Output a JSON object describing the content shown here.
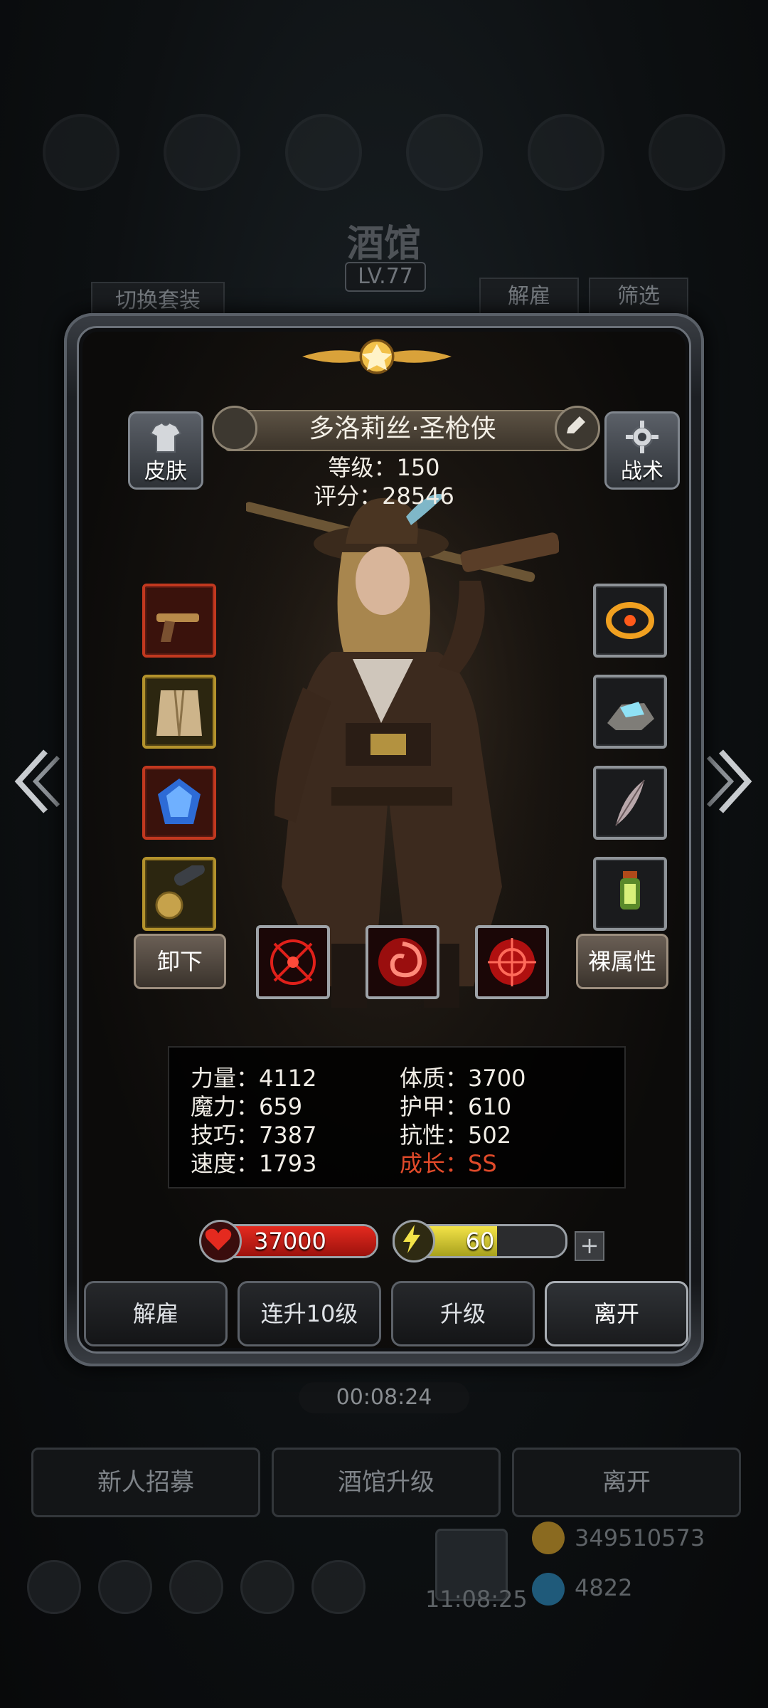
{
  "background": {
    "title": "酒馆",
    "level": "LV.77",
    "tab_switch_outfit": "切换套装",
    "tab_dismiss": "解雇",
    "tab_filter": "筛选",
    "timer": "00:08:24",
    "buttons": [
      "新人招募",
      "酒馆升级",
      "离开"
    ],
    "gold": "349510573",
    "gems": "4822",
    "clock": "11:08:25"
  },
  "hero": {
    "name": "多洛莉丝·圣枪侠",
    "level_text": "等级：150",
    "score_text": "评分：28546",
    "skin_label": "皮肤",
    "tactics_label": "战术"
  },
  "equipment_left": [
    {
      "icon": "pistol-icon",
      "rarity": "red"
    },
    {
      "icon": "fur-coat-icon",
      "rarity": "gold"
    },
    {
      "icon": "blue-gem-icon",
      "rarity": "red"
    },
    {
      "icon": "telescope-icon",
      "rarity": "gold"
    }
  ],
  "equipment_right": [
    {
      "icon": "flame-ring-icon",
      "rarity": "gray"
    },
    {
      "icon": "crystal-stone-icon",
      "rarity": "gray"
    },
    {
      "icon": "feather-icon",
      "rarity": "gray"
    },
    {
      "icon": "lantern-icon",
      "rarity": "gray"
    }
  ],
  "actions": {
    "unequip": "卸下",
    "base_attributes": "裸属性"
  },
  "skills": [
    "crosshair-skill-icon",
    "swirl-skill-icon",
    "target-skill-icon"
  ],
  "stats": {
    "strength": "力量：4112",
    "constitution": "体质：3700",
    "magic": "魔力：659",
    "armor": "护甲：610",
    "skill": "技巧：7387",
    "resistance": "抗性：502",
    "speed": "速度：1793",
    "growth": "成长：SS"
  },
  "resources": {
    "hp": "37000",
    "energy": "60",
    "energy_ratio": 0.6
  },
  "buttons": {
    "dismiss": "解雇",
    "upgrade10": "连升10级",
    "upgrade": "升级",
    "leave": "离开"
  },
  "colors": {
    "growth": "#e04a2a",
    "hp": "#e42a1f",
    "energy": "#f3e348"
  }
}
